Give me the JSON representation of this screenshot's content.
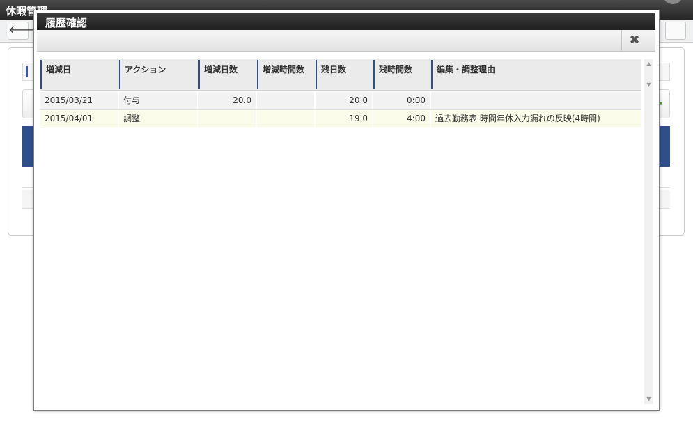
{
  "background": {
    "app_title": "休暇管理",
    "back_icon": "arrow-left-icon"
  },
  "modal": {
    "title": "履歴確認",
    "close_icon": "close-icon",
    "close_glyph": "✖"
  },
  "grid": {
    "columns": [
      "増減日",
      "アクション",
      "増減日数",
      "増減時間数",
      "残日数",
      "残時間数",
      "編集・調整理由"
    ],
    "rows": [
      {
        "date": "2015/03/21",
        "action": "付与",
        "change_days": "20.0",
        "change_hours": "",
        "remaining_days": "20.0",
        "remaining_hours": "0:00",
        "reason": ""
      },
      {
        "date": "2015/04/01",
        "action": "調整",
        "change_days": "",
        "change_hours": "",
        "remaining_days": "19.0",
        "remaining_hours": "4:00",
        "reason": "過去勤務表 時間年休入力漏れの反映(4時間)"
      }
    ]
  },
  "colors": {
    "accent": "#2f4f8a",
    "title_bar": "#262626",
    "highlight_row": "#fbfbe9"
  }
}
